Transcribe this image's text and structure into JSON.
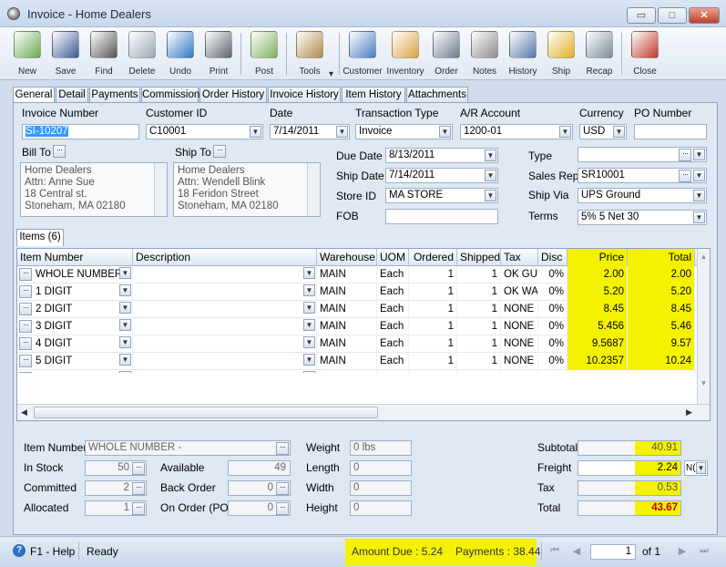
{
  "window": {
    "title": "Invoice - Home Dealers",
    "min_glyph": "▭",
    "max_glyph": "□",
    "close_glyph": "✕"
  },
  "toolbar": [
    {
      "label": "New",
      "icon": "new-document-icon",
      "color": "#6aa84f"
    },
    {
      "label": "Save",
      "icon": "floppy-disk-icon",
      "color": "#3d5a98"
    },
    {
      "label": "Find",
      "icon": "binoculars-icon",
      "color": "#555555"
    },
    {
      "label": "Delete",
      "icon": "trash-bin-icon",
      "color": "#9aa9b9"
    },
    {
      "label": "Undo",
      "icon": "undo-arrow-icon",
      "color": "#2f78c4"
    },
    {
      "label": "Print",
      "icon": "printer-icon",
      "color": "#5e6670"
    },
    {
      "label": "Post",
      "icon": "post-checklist-icon",
      "color": "#7fb05b"
    },
    {
      "label": "Tools",
      "icon": "tools-icon",
      "color": "#b08a4a"
    },
    {
      "label": "Customer",
      "icon": "customer-person-icon",
      "color": "#4a7cc0"
    },
    {
      "label": "Inventory",
      "icon": "inventory-boxes-icon",
      "color": "#d9a441"
    },
    {
      "label": "Order",
      "icon": "order-device-icon",
      "color": "#6b7b8c"
    },
    {
      "label": "Notes",
      "icon": "notes-pencil-icon",
      "color": "#8c8c8c"
    },
    {
      "label": "History",
      "icon": "history-person-icon",
      "color": "#5577aa"
    },
    {
      "label": "Ship",
      "icon": "forklift-icon",
      "color": "#e0b020"
    },
    {
      "label": "Recap",
      "icon": "recap-report-icon",
      "color": "#7c8c9c"
    },
    {
      "label": "Close",
      "icon": "close-window-icon",
      "color": "#c0392b"
    }
  ],
  "tools_dropdown_glyph": "▾",
  "tabs": [
    "General",
    "Detail",
    "Payments",
    "Commission",
    "Order History",
    "Invoice History",
    "Item History",
    "Attachments"
  ],
  "header": {
    "invoice_number": {
      "label": "Invoice Number",
      "value": "SI-10207"
    },
    "customer_id": {
      "label": "Customer ID",
      "value": "C10001"
    },
    "date": {
      "label": "Date",
      "value": "7/14/2011"
    },
    "transaction_type": {
      "label": "Transaction Type",
      "value": "Invoice"
    },
    "ar_account": {
      "label": "A/R Account",
      "value": "1200-01"
    },
    "currency": {
      "label": "Currency",
      "value": "USD"
    },
    "po_number": {
      "label": "PO Number",
      "value": ""
    },
    "bill_to": {
      "label": "Bill To",
      "lines": [
        "Home Dealers",
        "Attn: Anne Sue",
        "18 Central st.",
        "Stoneham, MA 02180"
      ]
    },
    "ship_to": {
      "label": "Ship To",
      "lines": [
        "Home Dealers",
        "Attn: Wendell Blink",
        "18 Feridon Street",
        "Stoneham, MA 02180"
      ]
    },
    "due_date": {
      "label": "Due Date",
      "value": "8/13/2011"
    },
    "ship_date": {
      "label": "Ship Date",
      "value": "7/14/2011"
    },
    "store_id": {
      "label": "Store ID",
      "value": "MA STORE"
    },
    "fob": {
      "label": "FOB",
      "value": ""
    },
    "type": {
      "label": "Type",
      "value": ""
    },
    "sales_rep": {
      "label": "Sales Rep",
      "value": "SR10001"
    },
    "ship_via": {
      "label": "Ship Via",
      "value": "UPS Ground"
    },
    "terms": {
      "label": "Terms",
      "value": "5% 5 Net 30"
    }
  },
  "items_tab": "Items (6)",
  "grid": {
    "columns": [
      "Item Number",
      "Description",
      "Warehouse",
      "UOM",
      "Ordered",
      "Shipped",
      "Tax",
      "Disc",
      "Price",
      "Total"
    ],
    "rows": [
      [
        "WHOLE NUMBER",
        "",
        "MAIN",
        "Each",
        "1",
        "1",
        "OK GU\\",
        "0%",
        "2.00",
        "2.00"
      ],
      [
        "1 DIGIT",
        "",
        "MAIN",
        "Each",
        "1",
        "1",
        "OK WA",
        "0%",
        "5.20",
        "5.20"
      ],
      [
        "2 DIGIT",
        "",
        "MAIN",
        "Each",
        "1",
        "1",
        "NONE",
        "0%",
        "8.45",
        "8.45"
      ],
      [
        "3 DIGIT",
        "",
        "MAIN",
        "Each",
        "1",
        "1",
        "NONE",
        "0%",
        "5.456",
        "5.46"
      ],
      [
        "4 DIGIT",
        "",
        "MAIN",
        "Each",
        "1",
        "1",
        "NONE",
        "0%",
        "9.5687",
        "9.57"
      ],
      [
        "5 DIGIT",
        "",
        "MAIN",
        "Each",
        "1",
        "1",
        "NONE",
        "0%",
        "10.2357",
        "10.24"
      ]
    ]
  },
  "bottom": {
    "item_number": {
      "label": "Item Number",
      "value": "WHOLE NUMBER -"
    },
    "in_stock": {
      "label": "In Stock",
      "value": "50"
    },
    "committed": {
      "label": "Committed",
      "value": "2"
    },
    "allocated": {
      "label": "Allocated",
      "value": "1"
    },
    "available": {
      "label": "Available",
      "value": "49"
    },
    "back_order": {
      "label": "Back Order",
      "value": "0"
    },
    "on_order": {
      "label": "On Order (PO)",
      "value": "0"
    },
    "weight": {
      "label": "Weight",
      "value": "0 lbs"
    },
    "length": {
      "label": "Length",
      "value": "0"
    },
    "width": {
      "label": "Width",
      "value": "0"
    },
    "height": {
      "label": "Height",
      "value": "0"
    }
  },
  "totals": {
    "subtotal": {
      "label": "Subtotal",
      "value": "40.91"
    },
    "freight": {
      "label": "Freight",
      "value": "2.24",
      "mode": "N("
    },
    "tax": {
      "label": "Tax",
      "value": "0.53"
    },
    "total": {
      "label": "Total",
      "value": "43.67"
    }
  },
  "status": {
    "help": "F1 - Help",
    "ready": "Ready",
    "amount_due": "Amount Due : 5.24",
    "payments": "Payments : 38.44",
    "page": "1",
    "of": "of 1"
  },
  "colors": {
    "highlight": "#f4f200",
    "total_red": "#c00000",
    "selection_blue": "#3399ff"
  }
}
